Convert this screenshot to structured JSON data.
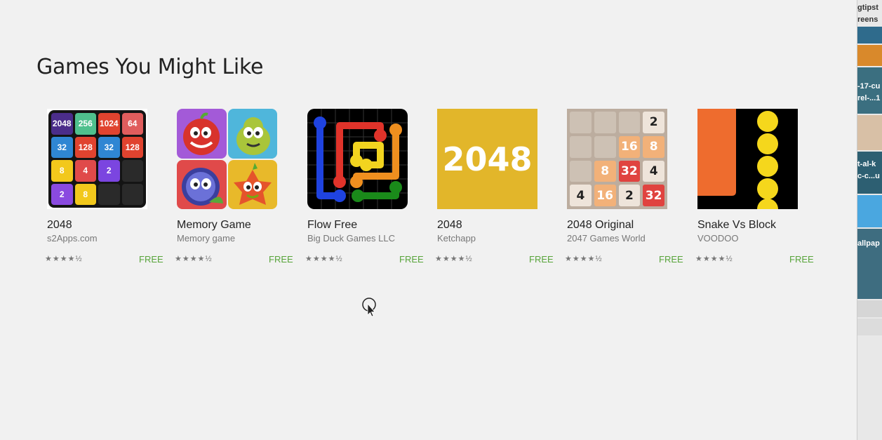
{
  "section": {
    "title": "Games You Might Like"
  },
  "apps": [
    {
      "name": "2048",
      "developer": "s2Apps.com",
      "rating": "★★★★½",
      "price": "FREE"
    },
    {
      "name": "Memory Game",
      "developer": "Memory game",
      "rating": "★★★★½",
      "price": "FREE"
    },
    {
      "name": "Flow Free",
      "developer": "Big Duck Games LLC",
      "rating": "★★★★½",
      "price": "FREE"
    },
    {
      "name": "2048",
      "developer": "Ketchapp",
      "rating": "★★★★½",
      "price": "FREE"
    },
    {
      "name": "2048 Original",
      "developer": "2047 Games World",
      "rating": "★★★★½",
      "price": "FREE"
    },
    {
      "name": "Snake Vs Block",
      "developer": "VOODOO",
      "rating": "★★★★½",
      "price": "FREE"
    }
  ],
  "thumbs": {
    "grid2048": [
      "2048",
      "256",
      "1024",
      "64",
      "32",
      "128",
      "32",
      "128",
      "8",
      "4",
      "2",
      "",
      "2",
      "8",
      "",
      ""
    ],
    "ketchapp": "2048",
    "original": [
      "",
      "",
      "",
      "2",
      "",
      "",
      "16",
      "8",
      "",
      "8",
      "32",
      "4",
      "4",
      "16",
      "2",
      "32"
    ]
  },
  "sidebar": {
    "items": [
      "gtipst",
      "reens",
      "-17-cu",
      "rel-...1",
      "t-al-k",
      "c-c...u",
      "allpap"
    ]
  },
  "colors": {
    "free": "#58a43a",
    "background": "#f1f1f1"
  }
}
